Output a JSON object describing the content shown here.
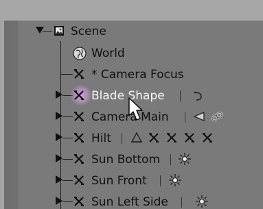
{
  "scene": {
    "label": "Scene"
  },
  "rows": [
    {
      "label": "World",
      "icon": "world-icon"
    },
    {
      "label": "* Camera Focus",
      "icon": "empty-axes-icon"
    },
    {
      "label": "Blade Shape",
      "icon": "empty-axes-icon",
      "selected": true,
      "children_icons": [
        "curve-icon"
      ]
    },
    {
      "label": "Camera Main",
      "icon": "empty-axes-icon",
      "children_icons": [
        "camera-icon",
        "link-icon"
      ]
    },
    {
      "label": "Hilt",
      "icon": "empty-axes-icon",
      "children_icons": [
        "armature-icon",
        "empty-axes-icon",
        "empty-axes-icon",
        "empty-axes-icon",
        "empty-axes-icon"
      ]
    },
    {
      "label": "Sun Bottom",
      "icon": "empty-axes-icon",
      "children_icons": [
        "sun-lamp-icon"
      ]
    },
    {
      "label": "Sun Front",
      "icon": "empty-axes-icon",
      "children_icons": [
        "sun-lamp-icon"
      ]
    },
    {
      "label": "Sun Left Side",
      "icon": "empty-axes-icon",
      "children_icons": [
        "sun-lamp-icon"
      ]
    }
  ],
  "colors": {
    "background": "#7a7a7a",
    "header": "#a7a7a7",
    "selection_text": "#f4f4f4",
    "selection_glow": "#c8a0d0"
  }
}
